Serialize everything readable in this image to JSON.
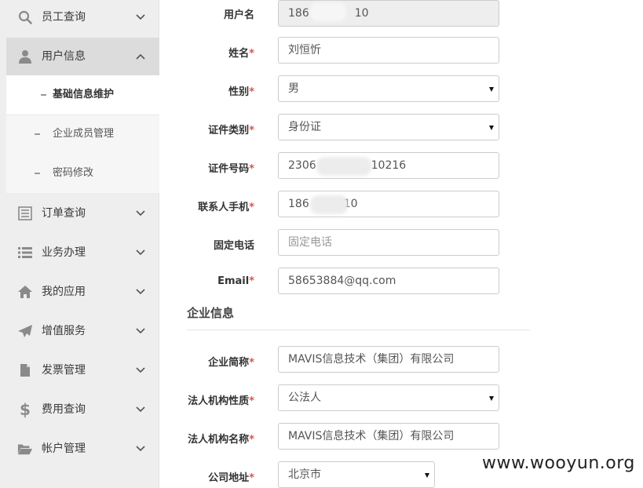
{
  "sidebar": {
    "items": [
      {
        "label": "员工查询",
        "icon": "search-icon"
      },
      {
        "label": "用户信息",
        "icon": "user-icon"
      },
      {
        "label": "订单查询",
        "icon": "list-icon"
      },
      {
        "label": "业务办理",
        "icon": "bulleted-list-icon"
      },
      {
        "label": "我的应用",
        "icon": "home-icon"
      },
      {
        "label": "增值服务",
        "icon": "paper-plane-icon"
      },
      {
        "label": "发票管理",
        "icon": "file-icon"
      },
      {
        "label": "费用查询",
        "icon": "dollar-icon"
      },
      {
        "label": "帐户管理",
        "icon": "folder-open-icon"
      }
    ],
    "submenu": [
      {
        "label": "基础信息维护"
      },
      {
        "label": "企业成员管理"
      },
      {
        "label": "密码修改"
      }
    ]
  },
  "form": {
    "username": {
      "label": "用户名",
      "value_prefix": "186",
      "value_suffix": "10"
    },
    "name": {
      "label": "姓名",
      "value": "刘恒忻"
    },
    "gender": {
      "label": "性别",
      "value": "男"
    },
    "id_type": {
      "label": "证件类别",
      "value": "身份证"
    },
    "id_number": {
      "label": "证件号码",
      "value_prefix": "2306",
      "value_suffix": "10216"
    },
    "mobile": {
      "label": "联系人手机",
      "value_prefix": "186",
      "value_suffix": "10"
    },
    "phone": {
      "label": "固定电话",
      "placeholder": "固定电话"
    },
    "email": {
      "label": "Email",
      "value": "58653884@qq.com"
    },
    "company_section": "企业信息",
    "company_short": {
      "label": "企业简称",
      "value": "MAVIS信息技术（集团）有限公司"
    },
    "legal_type": {
      "label": "法人机构性质",
      "value": "公法人"
    },
    "legal_name": {
      "label": "法人机构名称",
      "value": "MAVIS信息技术（集团）有限公司"
    },
    "address": {
      "label": "公司地址",
      "value": "北京市"
    }
  },
  "required_mark": "*",
  "watermark": "www.wooyun.org",
  "colors": {
    "required": "#d9534f",
    "sidebar_bg": "#eeeeee",
    "active_bg": "#dcdcdc"
  }
}
